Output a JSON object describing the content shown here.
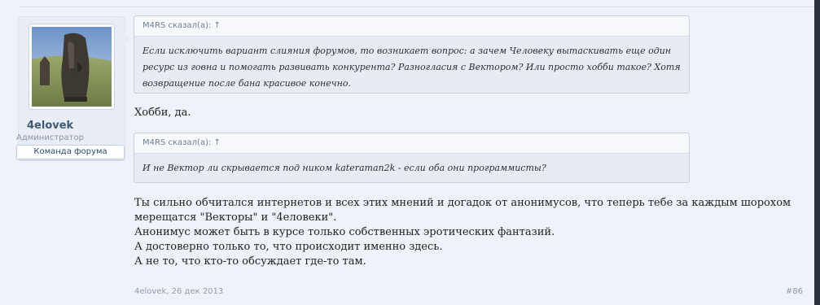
{
  "author": {
    "username": "4elovek",
    "title": "Администратор",
    "banner": "Команда форума"
  },
  "quotes": [
    {
      "header": "M4RS сказал(а): ↑",
      "lines": [
        "Если исключить вариант слияния форумов, то возникает вопрос: а зачем Человеку вытаскивать еще один",
        "ресурс из говна и помогать развивать конкурента? Разногласия с Вектором? Или просто хобби такое? Хотя",
        "возвращение после бана красивое конечно."
      ]
    },
    {
      "header": "M4RS сказал(а): ↑",
      "lines": [
        "И не Вектор ли скрывается под ником kateraman2k - если оба они программисты?"
      ]
    }
  ],
  "reply_1": "Хобби, да.",
  "reply_2_lines": [
    "Ты сильно обчитался интернетов и всех этих мнений и догадок от анонимусов, что теперь тебе за каждым шорохом",
    "мерещатся \"Векторы\" и \"4еловеки\".",
    "Анонимус может быть в курсе только собственных эротических фантазий.",
    "А достоверно только то, что происходит именно здесь.",
    "А не то, что кто-то обсуждает где-то там."
  ],
  "meta": {
    "author_date": "4elovek, 26 дек 2013",
    "post_number": "#86"
  },
  "colors": {
    "page_bg": "#f0f2fa",
    "quote_bg": "#e7ebf3",
    "username": "#3f5a73"
  },
  "icons": {
    "avatar": "moai-statue-photo"
  }
}
